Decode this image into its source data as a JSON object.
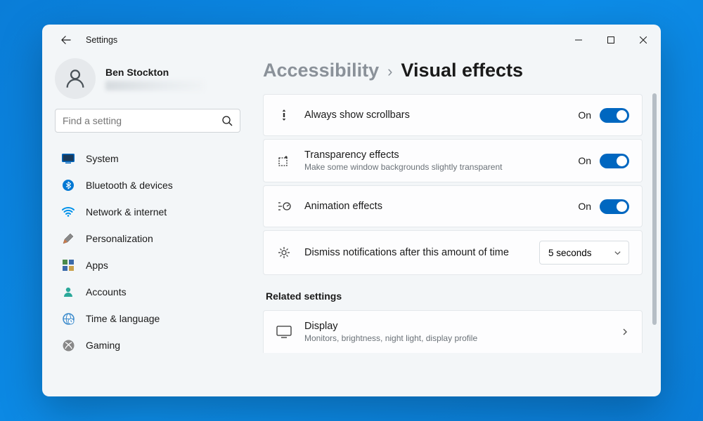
{
  "titlebar": {
    "app_title": "Settings"
  },
  "profile": {
    "name": "Ben Stockton"
  },
  "search": {
    "placeholder": "Find a setting"
  },
  "nav": {
    "items": [
      {
        "label": "System"
      },
      {
        "label": "Bluetooth & devices"
      },
      {
        "label": "Network & internet"
      },
      {
        "label": "Personalization"
      },
      {
        "label": "Apps"
      },
      {
        "label": "Accounts"
      },
      {
        "label": "Time & language"
      },
      {
        "label": "Gaming"
      }
    ]
  },
  "breadcrumb": {
    "parent": "Accessibility",
    "current": "Visual effects"
  },
  "settings": [
    {
      "title": "Always show scrollbars",
      "subtitle": "",
      "state_label": "On",
      "type": "toggle"
    },
    {
      "title": "Transparency effects",
      "subtitle": "Make some window backgrounds slightly transparent",
      "state_label": "On",
      "type": "toggle"
    },
    {
      "title": "Animation effects",
      "subtitle": "",
      "state_label": "On",
      "type": "toggle"
    },
    {
      "title": "Dismiss notifications after this amount of time",
      "subtitle": "",
      "select_value": "5 seconds",
      "type": "select"
    }
  ],
  "related": {
    "header": "Related settings",
    "items": [
      {
        "title": "Display",
        "subtitle": "Monitors, brightness, night light, display profile"
      }
    ]
  }
}
